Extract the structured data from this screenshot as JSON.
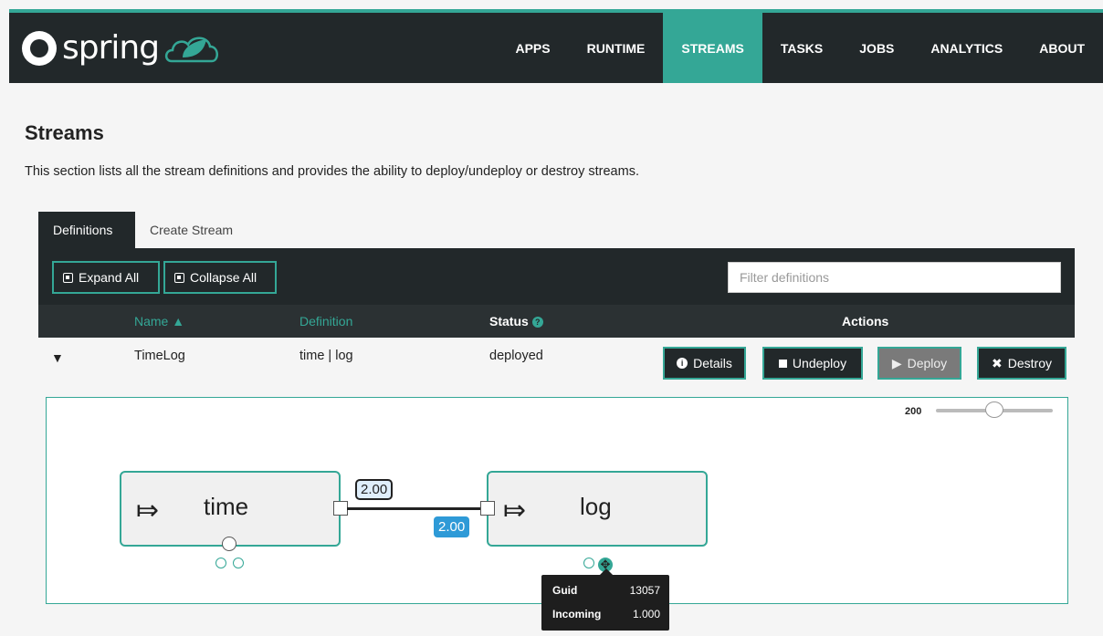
{
  "brand": {
    "name": "spring"
  },
  "nav": {
    "items": [
      {
        "label": "APPS",
        "active": false
      },
      {
        "label": "RUNTIME",
        "active": false
      },
      {
        "label": "STREAMS",
        "active": true
      },
      {
        "label": "TASKS",
        "active": false
      },
      {
        "label": "JOBS",
        "active": false
      },
      {
        "label": "ANALYTICS",
        "active": false
      },
      {
        "label": "ABOUT",
        "active": false
      }
    ]
  },
  "page": {
    "title": "Streams",
    "description": "This section lists all the stream definitions and provides the ability to deploy/undeploy or destroy streams."
  },
  "tabs": [
    {
      "label": "Definitions",
      "active": true
    },
    {
      "label": "Create Stream",
      "active": false
    }
  ],
  "toolbar": {
    "expand_all": "Expand All",
    "collapse_all": "Collapse All",
    "filter_placeholder": "Filter definitions"
  },
  "table": {
    "columns": {
      "name": "Name",
      "definition": "Definition",
      "status": "Status",
      "actions": "Actions"
    },
    "rows": [
      {
        "name": "TimeLog",
        "definition": "time | log",
        "status": "deployed"
      }
    ],
    "actions": {
      "details": "Details",
      "undeploy": "Undeploy",
      "deploy": "Deploy",
      "destroy": "Destroy"
    }
  },
  "graph": {
    "zoom": "200",
    "nodes": [
      {
        "label": "time"
      },
      {
        "label": "log"
      }
    ],
    "link_rates": {
      "outgoing": "2.00",
      "incoming": "2.00"
    },
    "tooltip": [
      {
        "key": "Guid",
        "value": "13057"
      },
      {
        "key": "Incoming",
        "value": "1.000"
      }
    ]
  },
  "colors": {
    "accent": "#34a796",
    "dark": "#22282a",
    "badge_blue": "#2e9ad7"
  }
}
